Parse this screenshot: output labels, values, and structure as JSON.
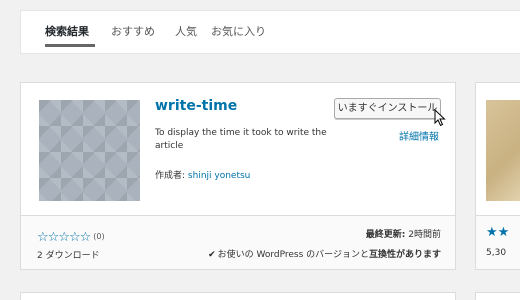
{
  "tabs": [
    {
      "label": "検索結果",
      "current": true
    },
    {
      "label": "おすすめ",
      "current": false
    },
    {
      "label": "人気",
      "current": false
    },
    {
      "label": "お気に入り",
      "current": false
    }
  ],
  "plugin": {
    "name": "write-time",
    "install_label": "いますぐインストール",
    "details_label": "詳細情報",
    "description": "To display the time it took to write the article",
    "author_prefix": "作成者:",
    "author_name": "shinji yonetsu",
    "rating_count": "(0)",
    "downloads": "2 ダウンロード",
    "last_updated_label": "最終更新:",
    "last_updated_value": "2時間前",
    "compat_prefix": "お使いの WordPress のバージョンと",
    "compat_status": "互換性があります"
  },
  "neighbor_card": {
    "downloads_partial": "5,30"
  },
  "colors": {
    "link": "#0073aa",
    "background": "#f1f1f1"
  }
}
